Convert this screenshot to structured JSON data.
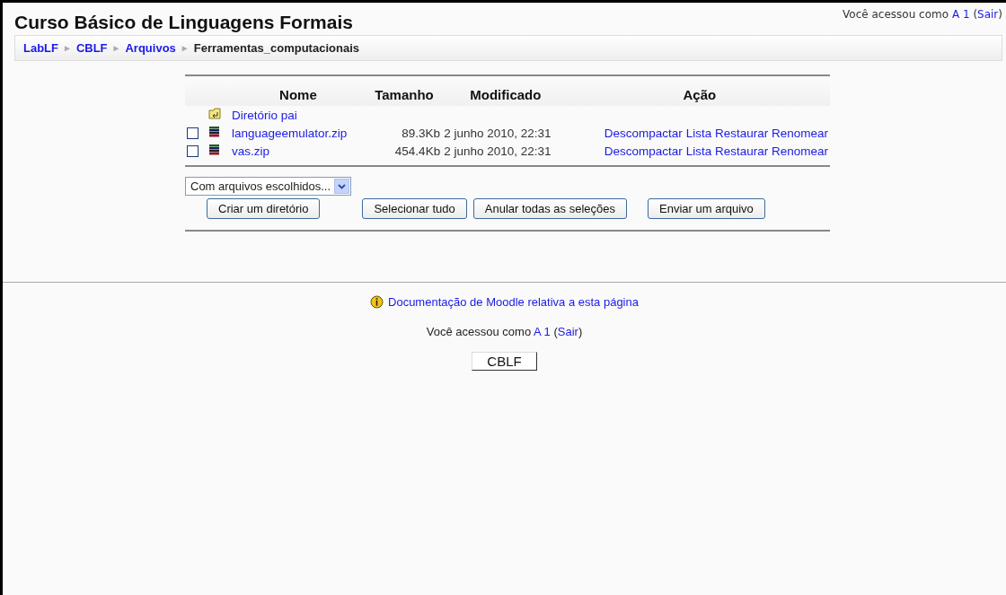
{
  "header": {
    "title": "Curso Básico de Linguagens Formais",
    "login": {
      "text": "Você acessou como",
      "user": "A 1",
      "open": "(",
      "logout": "Sair",
      "close": ")"
    }
  },
  "breadcrumb": {
    "links": [
      "LabLF",
      "CBLF",
      "Arquivos"
    ],
    "separator": "►",
    "current": "Ferramentas_computacionais"
  },
  "table": {
    "columns": [
      "Nome",
      "Tamanho",
      "Modificado",
      "Ação"
    ],
    "parent": {
      "name": "Diretório pai"
    },
    "rows": [
      {
        "checked": false,
        "name": "languageemulator.zip",
        "size": "89.3Kb",
        "modified": "2 junho 2010, 22:31",
        "actions": [
          "Descompactar",
          "Lista",
          "Restaurar",
          "Renomear"
        ]
      },
      {
        "checked": false,
        "name": "vas.zip",
        "size": "454.4Kb",
        "modified": "2 junho 2010, 22:31",
        "actions": [
          "Descompactar",
          "Lista",
          "Restaurar",
          "Renomear"
        ]
      }
    ]
  },
  "with_selected": {
    "value": "Com arquivos escolhidos..."
  },
  "buttons": [
    "Criar um diretório",
    "Selecionar tudo",
    "Anular todas as seleções",
    "Enviar um arquivo"
  ],
  "footer": {
    "doc_link": "Documentação de Moodle relativa a esta página",
    "login": {
      "text": "Você acessou como",
      "user": "A 1",
      "open": "(",
      "logout": "Sair",
      "close": ")"
    },
    "home_button": "CBLF"
  }
}
